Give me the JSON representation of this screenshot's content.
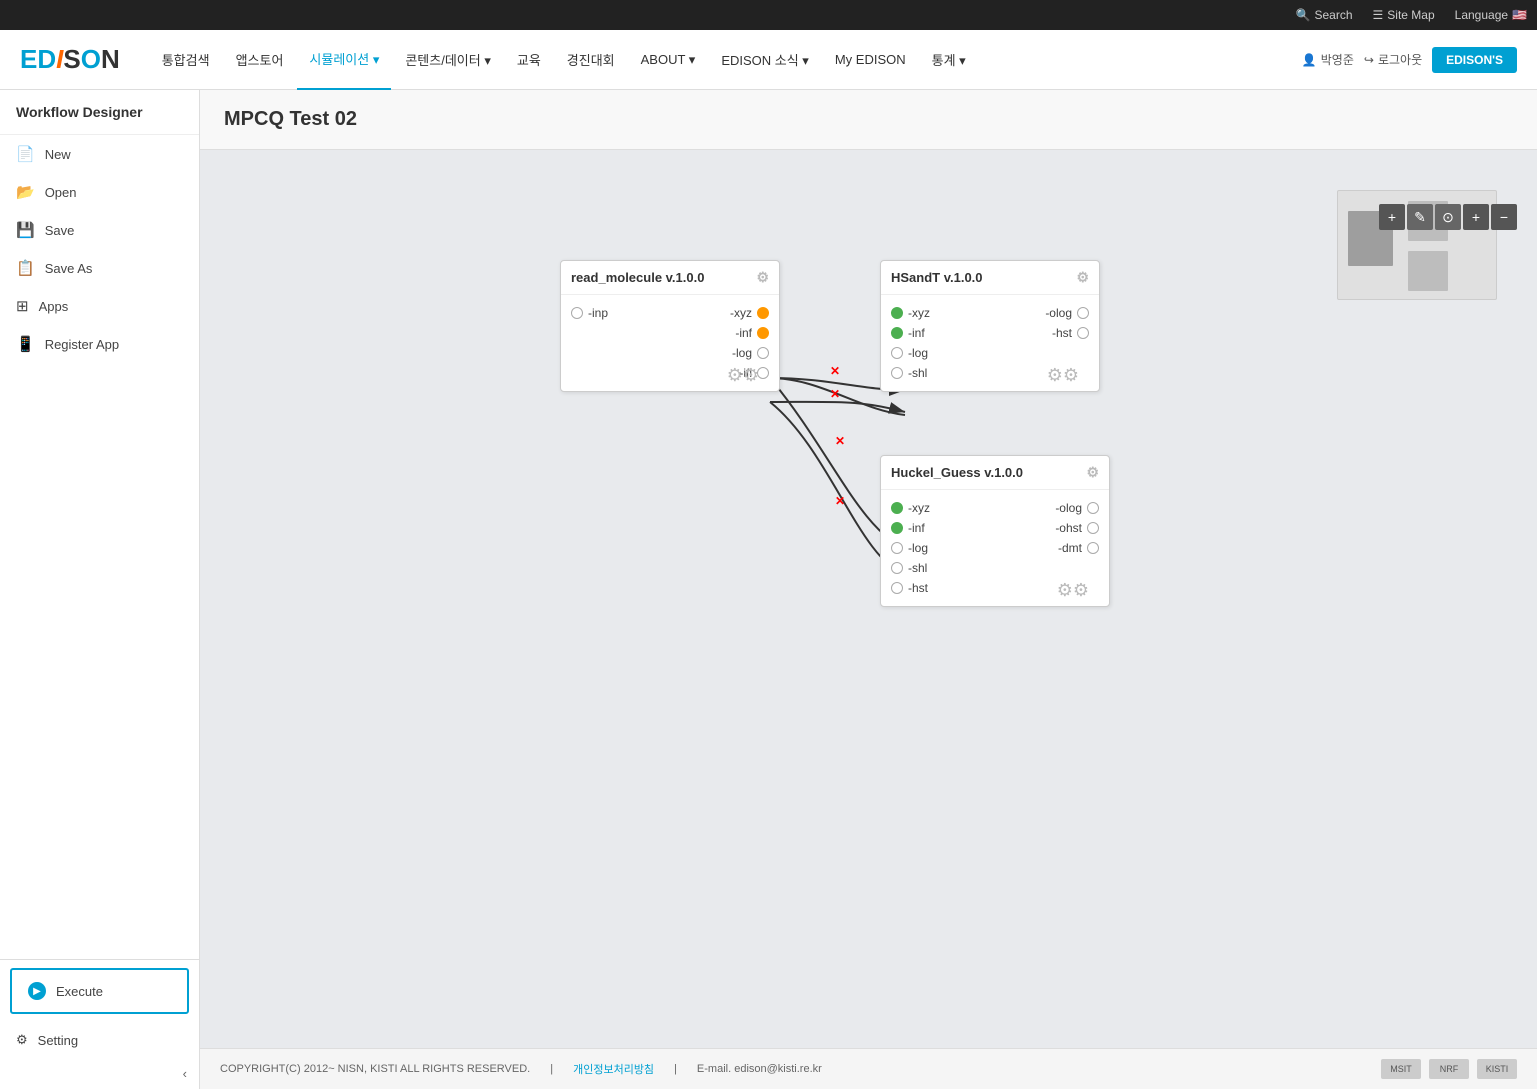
{
  "topbar": {
    "search_label": "Search",
    "sitemap_label": "Site Map",
    "language_label": "Language"
  },
  "navbar": {
    "logo": "EDISON",
    "items": [
      {
        "label": "통합검색",
        "active": false
      },
      {
        "label": "앱스토어",
        "active": false
      },
      {
        "label": "시뮬레이션",
        "active": true,
        "dropdown": true
      },
      {
        "label": "콘텐츠/데이터",
        "active": false,
        "dropdown": true
      },
      {
        "label": "교육",
        "active": false
      },
      {
        "label": "경진대회",
        "active": false
      },
      {
        "label": "ABOUT",
        "active": false,
        "dropdown": true
      },
      {
        "label": "EDISON 소식",
        "active": false,
        "dropdown": true
      },
      {
        "label": "My EDISON",
        "active": false
      },
      {
        "label": "통계",
        "active": false,
        "dropdown": true
      }
    ],
    "user_name": "박영준",
    "logout_label": "로그아웃",
    "edisons_label": "EDISON'S"
  },
  "sidebar": {
    "title": "Workflow Designer",
    "items": [
      {
        "label": "New",
        "icon": "file-icon"
      },
      {
        "label": "Open",
        "icon": "folder-icon"
      },
      {
        "label": "Save",
        "icon": "save-icon"
      },
      {
        "label": "Save As",
        "icon": "saveas-icon"
      },
      {
        "label": "Apps",
        "icon": "apps-icon"
      },
      {
        "label": "Register App",
        "icon": "register-icon"
      }
    ],
    "execute_label": "Execute",
    "setting_label": "Setting",
    "collapse_icon": "‹"
  },
  "page_title": "MPCQ Test 02",
  "nodes": {
    "read_molecule": {
      "title": "read_molecule v.1.0.0",
      "inputs": [
        "-inp"
      ],
      "outputs": [
        "-xyz",
        "-inf",
        "-log",
        "-ifl"
      ],
      "output_colors": [
        "orange",
        "orange",
        "empty",
        "empty"
      ]
    },
    "hsandt": {
      "title": "HSandT v.1.0.0",
      "inputs": [
        "-xyz",
        "-inf",
        "-log",
        "-shl"
      ],
      "input_colors": [
        "green",
        "green",
        "empty",
        "empty"
      ],
      "outputs": [
        "-olog",
        "-hst"
      ]
    },
    "huckel": {
      "title": "Huckel_Guess v.1.0.0",
      "inputs": [
        "-xyz",
        "-inf",
        "-log",
        "-shl",
        "-hst"
      ],
      "input_colors": [
        "green",
        "green",
        "empty",
        "empty",
        "empty"
      ],
      "outputs": [
        "-olog",
        "-ohst",
        "-dmt"
      ]
    }
  },
  "minimap": {
    "controls": [
      "+",
      "✎",
      "⊙",
      "+",
      "−"
    ]
  },
  "footer": {
    "copyright": "COPYRIGHT(C) 2012~ NISN, KISTI ALL RIGHTS RESERVED.",
    "privacy": "개인정보처리방침",
    "email_label": "E-mail. edison@kisti.re.kr"
  }
}
